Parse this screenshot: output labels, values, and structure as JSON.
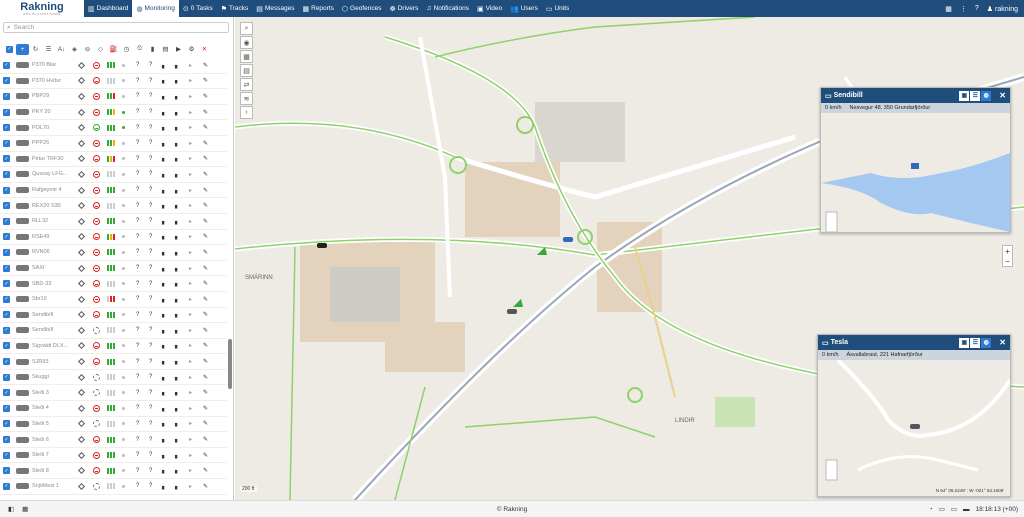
{
  "app": {
    "logo": "Rakning",
    "logo_sub": "GPS FLOTASTÝRING"
  },
  "nav": [
    {
      "label": "Dashboard",
      "icon": "chart-icon",
      "glyph": "▥",
      "active": false
    },
    {
      "label": "Monitoring",
      "icon": "globe-icon",
      "glyph": "◍",
      "active": true
    },
    {
      "label": "0 Tasks",
      "icon": "check-circle-icon",
      "glyph": "⊙",
      "active": false
    },
    {
      "label": "Tracks",
      "icon": "flag-icon",
      "glyph": "⚑",
      "active": false
    },
    {
      "label": "Messages",
      "icon": "message-icon",
      "glyph": "▤",
      "active": false
    },
    {
      "label": "Reports",
      "icon": "report-icon",
      "glyph": "▦",
      "active": false
    },
    {
      "label": "Geofences",
      "icon": "geofence-icon",
      "glyph": "⬡",
      "active": false
    },
    {
      "label": "Drivers",
      "icon": "driver-icon",
      "glyph": "☸",
      "active": false
    },
    {
      "label": "Notifications",
      "icon": "bell-icon",
      "glyph": "♫",
      "active": false
    },
    {
      "label": "Video",
      "icon": "video-icon",
      "glyph": "▣",
      "active": false
    },
    {
      "label": "Users",
      "icon": "users-icon",
      "glyph": "👥",
      "active": false
    },
    {
      "label": "Units",
      "icon": "bus-icon",
      "glyph": "▭",
      "active": false
    }
  ],
  "topright": {
    "user": "rakning"
  },
  "search": {
    "placeholder": "Search"
  },
  "units": [
    {
      "name": "P370 Blár",
      "circ": "r",
      "bars": [
        "#3a3",
        "#3a3",
        "#3a3"
      ],
      "dot": "#bbb"
    },
    {
      "name": "P370 Hvítur",
      "circ": "r",
      "bars": [
        "#ccc",
        "#ccc",
        "#ccc"
      ],
      "dot": "#bbb"
    },
    {
      "name": "PBP29",
      "circ": "r",
      "bars": [
        "#3a3",
        "#3a3",
        "#d22"
      ],
      "dot": "#bbb"
    },
    {
      "name": "PKY 20",
      "circ": "r",
      "bars": [
        "#3a3",
        "#3a3",
        "#e6b800"
      ],
      "dot": "#3a3"
    },
    {
      "name": "POL70",
      "circ": "g",
      "bars": [
        "#3a3",
        "#3a3",
        "#3a3"
      ],
      "dot": "#3a3"
    },
    {
      "name": "PPP26",
      "circ": "r",
      "bars": [
        "#3a3",
        "#3a3",
        "#e6b800"
      ],
      "dot": "#bbb"
    },
    {
      "name": "Pétur TRF30",
      "circ": "r",
      "bars": [
        "#3a3",
        "#e6b800",
        "#d22"
      ],
      "dot": "#bbb"
    },
    {
      "name": "Qussay LFG...",
      "circ": "r",
      "bars": [
        "#ccc",
        "#ccc",
        "#ccc"
      ],
      "dot": "#bbb"
    },
    {
      "name": "Rafgeymir 4",
      "circ": "r",
      "bars": [
        "#3a3",
        "#3a3",
        "#3a3"
      ],
      "dot": "#bbb"
    },
    {
      "name": "REX20 S30",
      "circ": "r",
      "bars": [
        "#ccc",
        "#ccc",
        "#ccc"
      ],
      "dot": "#bbb"
    },
    {
      "name": "RLL32",
      "circ": "r",
      "bars": [
        "#3a3",
        "#3a3",
        "#3a3"
      ],
      "dot": "#bbb"
    },
    {
      "name": "RSE49",
      "circ": "r",
      "bars": [
        "#3a3",
        "#e6b800",
        "#d22"
      ],
      "dot": "#bbb"
    },
    {
      "name": "RVN06",
      "circ": "r",
      "bars": [
        "#3a3",
        "#3a3",
        "#3a3"
      ],
      "dot": "#bbb"
    },
    {
      "name": "SAXI",
      "circ": "r",
      "bars": [
        "#3a3",
        "#3a3",
        "#3a3"
      ],
      "dot": "#bbb"
    },
    {
      "name": "SBD-33",
      "circ": "r",
      "bars": [
        "#ccc",
        "#ccc",
        "#ccc"
      ],
      "dot": "#bbb"
    },
    {
      "name": "Sbr10",
      "circ": "r",
      "bars": [
        "#ccc",
        "#d22",
        "#d22"
      ],
      "dot": "#bbb"
    },
    {
      "name": "Sendibíll",
      "circ": "r",
      "bars": [
        "#3a3",
        "#3a3",
        "#3a3"
      ],
      "dot": "#bbb"
    },
    {
      "name": "Sendibíll",
      "circ": "d",
      "bars": [
        "#ccc",
        "#ccc",
        "#ccc"
      ],
      "dot": "#bbb"
    },
    {
      "name": "Sigvaldi DLX...",
      "circ": "r",
      "bars": [
        "#3a3",
        "#3a3",
        "#3a3"
      ],
      "dot": "#bbb"
    },
    {
      "name": "SJR93",
      "circ": "r",
      "bars": [
        "#3a3",
        "#3a3",
        "#3a3"
      ],
      "dot": "#bbb"
    },
    {
      "name": "Skuggi",
      "circ": "d",
      "bars": [
        "#ccc",
        "#ccc",
        "#ccc"
      ],
      "dot": "#bbb"
    },
    {
      "name": "Sleði 3",
      "circ": "d",
      "bars": [
        "#ccc",
        "#ccc",
        "#ccc"
      ],
      "dot": "#bbb"
    },
    {
      "name": "Sleði 4",
      "circ": "r",
      "bars": [
        "#3a3",
        "#3a3",
        "#3a3"
      ],
      "dot": "#bbb"
    },
    {
      "name": "Sleði 5",
      "circ": "d",
      "bars": [
        "#ccc",
        "#ccc",
        "#ccc"
      ],
      "dot": "#bbb"
    },
    {
      "name": "Sleði 6",
      "circ": "r",
      "bars": [
        "#3a3",
        "#3a3",
        "#3a3"
      ],
      "dot": "#bbb"
    },
    {
      "name": "Sleði 7",
      "circ": "r",
      "bars": [
        "#3a3",
        "#3a3",
        "#3a3"
      ],
      "dot": "#bbb"
    },
    {
      "name": "Sleði 8",
      "circ": "r",
      "bars": [
        "#3a3",
        "#3a3",
        "#3a3"
      ],
      "dot": "#bbb"
    },
    {
      "name": "Snjóblesi 1",
      "circ": "d",
      "bars": [
        "#ccc",
        "#ccc",
        "#ccc"
      ],
      "dot": "#bbb"
    }
  ],
  "map": {
    "scale": "200 ft",
    "labels": [
      "SMÁRINN",
      "LINDIR"
    ]
  },
  "popups": [
    {
      "title": "Sendibíll",
      "speed": "0 km/h",
      "address": "Nesvegur 48, 350 Grundarfjörður"
    },
    {
      "title": "Tesla",
      "speed": "0 km/h",
      "address": "Ásvallabraut, 221 Hafnarfjörður",
      "coords": "N 64° 06.2249' : W -021° 53.1608'"
    }
  ],
  "footer": {
    "copyright": "© Rakning",
    "time": "18:18:13 (+00)"
  }
}
